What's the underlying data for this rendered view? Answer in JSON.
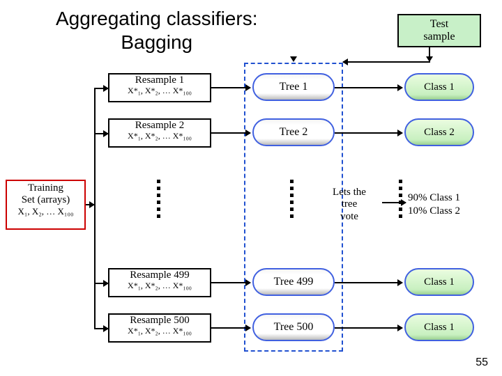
{
  "title_line1": "Aggregating classifiers:",
  "title_line2": "Bagging",
  "test_sample": {
    "line1": "Test",
    "line2": "sample"
  },
  "training": {
    "line1": "Training",
    "line2": "Set (arrays)",
    "members": "X₁, X₂, … X₁₀₀"
  },
  "resamples": {
    "r1": {
      "title": "Resample 1",
      "detail": "X*₁, X*₂, … X*₁₀₀"
    },
    "r2": {
      "title": "Resample 2",
      "detail": "X*₁, X*₂, … X*₁₀₀"
    },
    "r499": {
      "title": "Resample 499",
      "detail": "X*₁, X*₂, … X*₁₀₀"
    },
    "r500": {
      "title": "Resample 500",
      "detail": "X*₁, X*₂, … X*₁₀₀"
    }
  },
  "trees": {
    "t1": "Tree 1",
    "t2": "Tree 2",
    "t499": "Tree 499",
    "t500": "Tree 500"
  },
  "classes": {
    "c1": "Class 1",
    "c2": "Class 2",
    "c499": "Class 1",
    "c500": "Class 1"
  },
  "vote": {
    "line1": "Lets the",
    "line2": "tree",
    "line3": "vote"
  },
  "final": {
    "line1": "90% Class 1",
    "line2": "10% Class 2"
  },
  "pagenum": "55"
}
